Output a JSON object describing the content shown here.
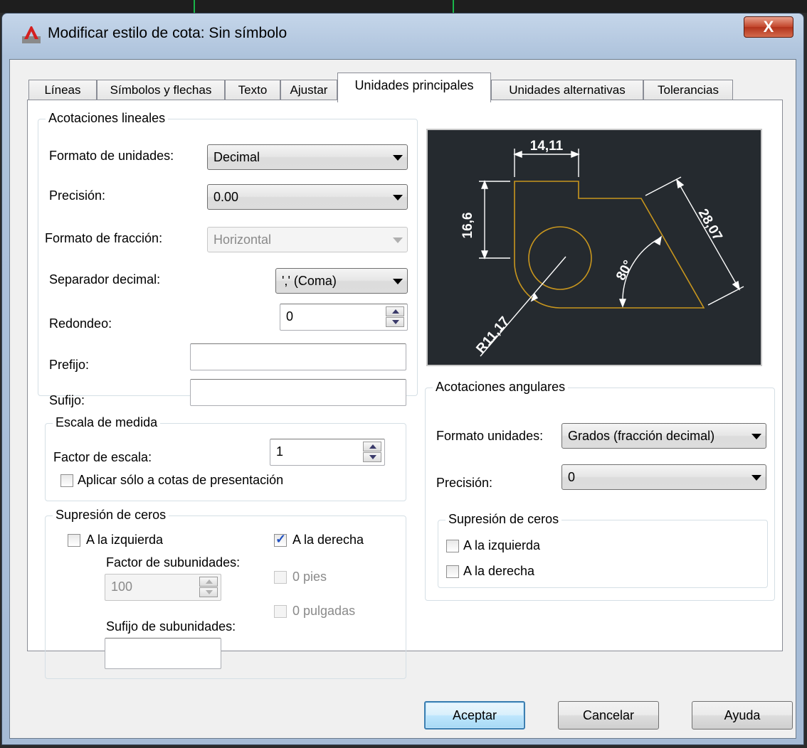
{
  "window": {
    "title": "Modificar estilo de cota: Sin símbolo",
    "close_label": "X"
  },
  "tabs": [
    {
      "label": "Líneas"
    },
    {
      "label": "Símbolos y flechas"
    },
    {
      "label": "Texto"
    },
    {
      "label": "Ajustar"
    },
    {
      "label": "Unidades principales",
      "active": true
    },
    {
      "label": "Unidades alternativas"
    },
    {
      "label": "Tolerancias"
    }
  ],
  "linear": {
    "title": "Acotaciones lineales",
    "unit_format": {
      "label": "Formato de unidades:",
      "value": "Decimal"
    },
    "precision": {
      "label": "Precisión:",
      "value": "0.00"
    },
    "fraction_format": {
      "label": "Formato de fracción:",
      "value": "Horizontal",
      "enabled": false
    },
    "decimal_separator": {
      "label": "Separador decimal:",
      "value": "',' (Coma)"
    },
    "round_off": {
      "label": "Redondeo:",
      "value": "0"
    },
    "prefix": {
      "label": "Prefijo:",
      "value": ""
    },
    "suffix": {
      "label": "Sufijo:",
      "value": ""
    }
  },
  "scale": {
    "title": "Escala de medida",
    "factor": {
      "label": "Factor de escala:",
      "value": "1"
    },
    "layout_only": {
      "label": "Aplicar sólo a cotas de presentación",
      "checked": false
    }
  },
  "zero_linear": {
    "title": "Supresión de ceros",
    "leading": {
      "label": "A la izquierda",
      "checked": false
    },
    "trailing": {
      "label": "A la derecha",
      "checked": true
    },
    "sub_factor": {
      "label": "Factor de subunidades:",
      "value": "100",
      "enabled": false
    },
    "feet": {
      "label": "0 pies",
      "enabled": false
    },
    "inches": {
      "label": "0 pulgadas",
      "enabled": false
    },
    "sub_suffix": {
      "label": "Sufijo de subunidades:",
      "value": ""
    }
  },
  "preview": {
    "dim_top": "14,11",
    "dim_left": "16,6",
    "dim_diag": "28,07",
    "dim_angle": "80°",
    "dim_radius": "R11,17",
    "colors": {
      "background": "#252a2f",
      "geometry": "#c8961e",
      "dimensions": "#ffffff"
    }
  },
  "angular": {
    "title": "Acotaciones angulares",
    "unit_format": {
      "label": "Formato unidades:",
      "value": "Grados (fracción decimal)"
    },
    "precision": {
      "label": "Precisión:",
      "value": "0"
    },
    "zero": {
      "title": "Supresión de ceros",
      "leading": {
        "label": "A la izquierda",
        "checked": false
      },
      "trailing": {
        "label": "A la derecha",
        "checked": false
      }
    }
  },
  "buttons": {
    "ok": "Aceptar",
    "cancel": "Cancelar",
    "help": "Ayuda"
  }
}
